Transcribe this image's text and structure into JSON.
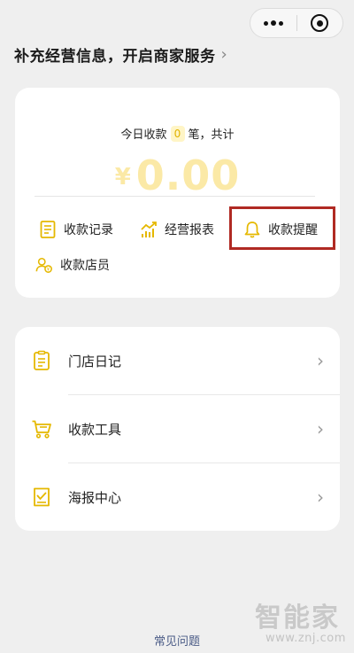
{
  "header": {
    "title": "补充经营信息，开启商家服务",
    "chevron": "›"
  },
  "summary": {
    "today_prefix": "今日收款",
    "count": "0",
    "today_suffix": "笔，共计",
    "currency": "¥",
    "amount": "0.00"
  },
  "actions": [
    {
      "label": "收款记录",
      "icon": "document-icon"
    },
    {
      "label": "经营报表",
      "icon": "trend-chart-icon"
    },
    {
      "label": "收款提醒",
      "icon": "bell-icon"
    },
    {
      "label": "收款店员",
      "icon": "staff-icon"
    }
  ],
  "menu": [
    {
      "label": "门店日记",
      "icon": "diary-icon"
    },
    {
      "label": "收款工具",
      "icon": "cart-icon"
    },
    {
      "label": "海报中心",
      "icon": "poster-icon"
    }
  ],
  "footer": {
    "faq": "常见问题"
  },
  "watermark": {
    "text": "智能家",
    "url": "www.znj.com"
  },
  "colors": {
    "accent": "#f2c200",
    "highlight_border": "#b02a23",
    "background": "#efefef"
  }
}
